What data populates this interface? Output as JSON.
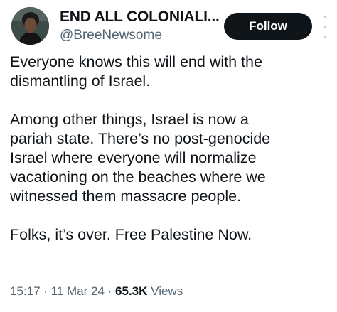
{
  "author": {
    "display_name": "END ALL COLONIALI...",
    "handle": "@BreeNewsome"
  },
  "follow_label": "Follow",
  "tweet": {
    "paragraphs": [
      "Everyone knows this will end with the dismantling of Israel.",
      "Among other things, Israel is now a pariah state. There’s no post-genocide Israel where everyone will normalize vacationing on the beaches where we witnessed them massacre people.",
      "Folks, it’s over. Free Palestine Now."
    ],
    "lines": [
      [
        "Everyone knows this will end with the",
        "dismantling of Israel."
      ],
      [
        "Among other things, Israel is now a",
        "pariah state. There’s no post-genocide",
        "Israel where everyone will normalize",
        "vacationing on the beaches where we",
        "witnessed them massacre people."
      ],
      [
        "Folks, it’s over. Free Palestine Now."
      ]
    ]
  },
  "meta": {
    "time": "15:17",
    "separator": " · ",
    "date": "11 Mar 24",
    "views_count": "65.3K",
    "views_label": "Views"
  },
  "icons": {
    "avatar": "profile-photo",
    "more": "more-options-icon"
  },
  "colors": {
    "text": "#0f1419",
    "secondary": "#536471",
    "button_bg": "#0f1419",
    "button_text": "#ffffff"
  }
}
